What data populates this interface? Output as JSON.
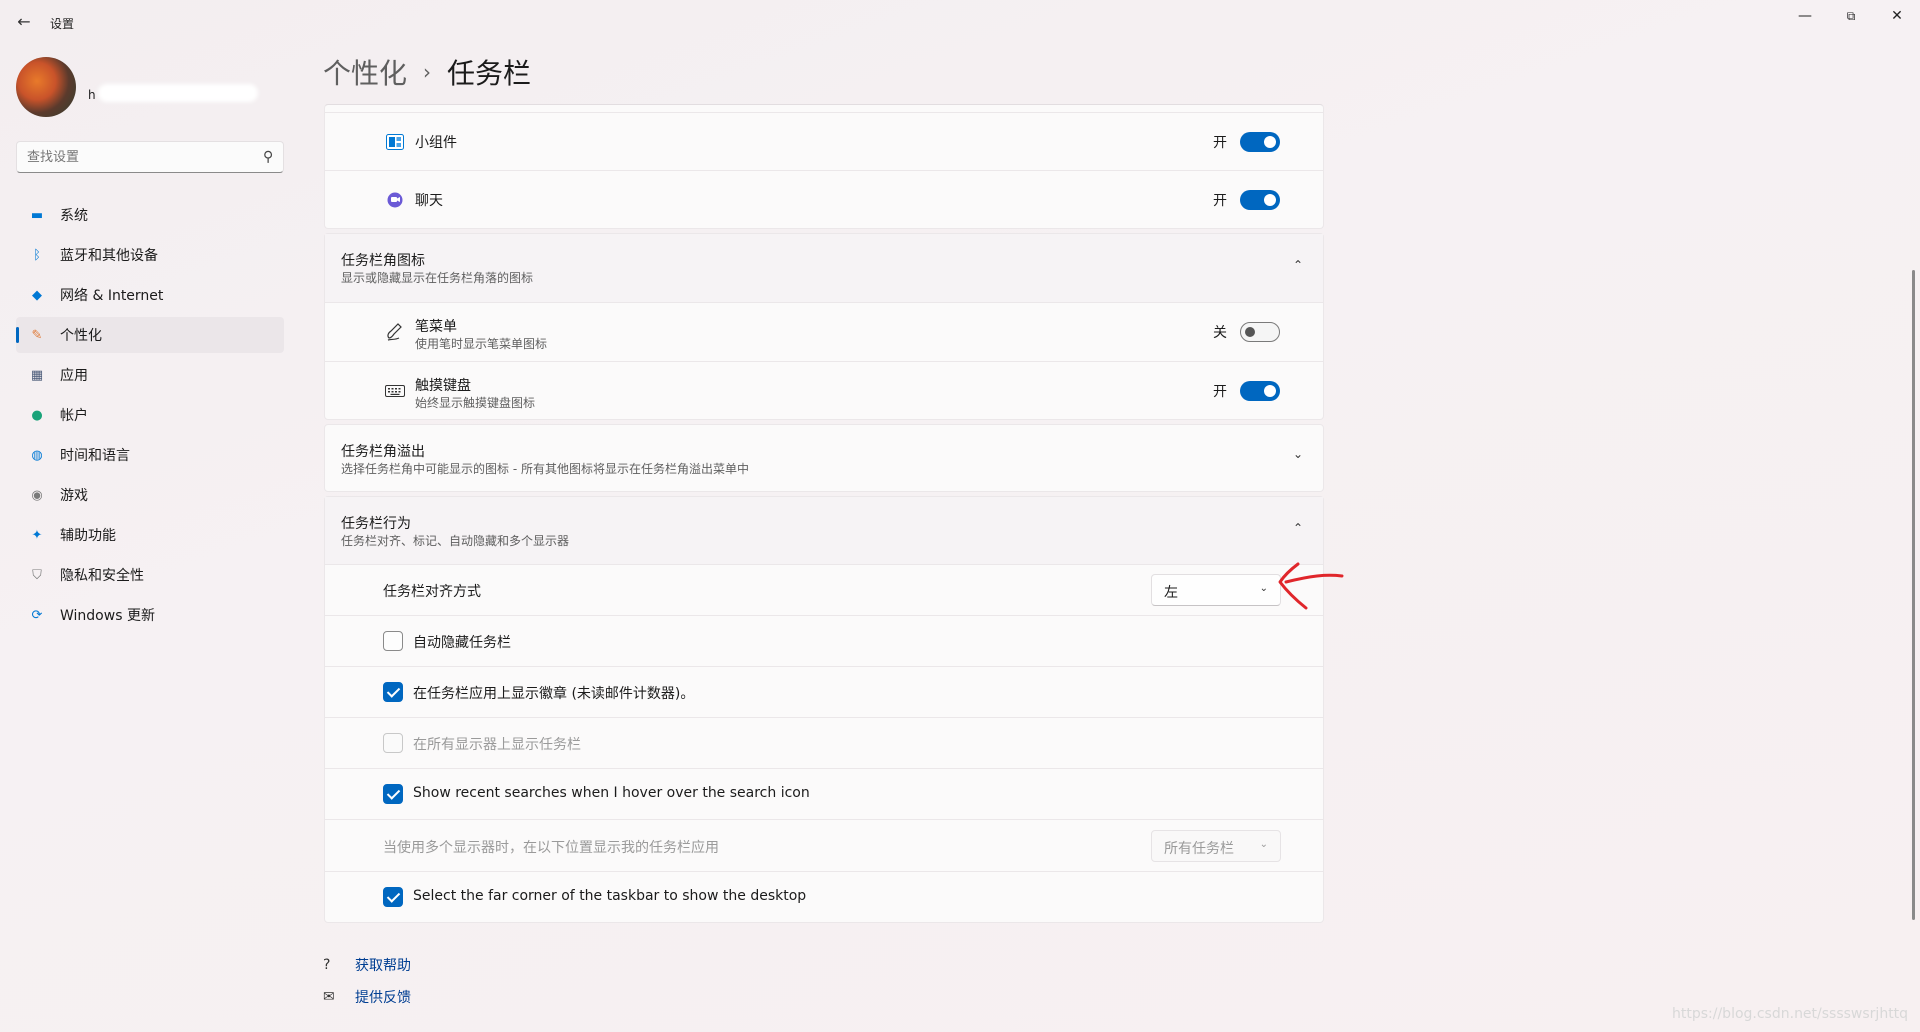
{
  "window": {
    "title": "设置",
    "back_glyph": "←",
    "minimize_glyph": "—",
    "maximize_glyph": "⧉",
    "close_glyph": "✕"
  },
  "profile": {
    "name": "h"
  },
  "search": {
    "placeholder": "查找设置",
    "icon": "search-icon"
  },
  "sidebar": {
    "items": [
      {
        "label": "系统",
        "icon": "monitor-icon",
        "glyph": "▬",
        "color": "#0078d4"
      },
      {
        "label": "蓝牙和其他设备",
        "icon": "bluetooth-icon",
        "glyph": "ᛒ",
        "color": "#0078d4"
      },
      {
        "label": "网络 & Internet",
        "icon": "wifi-icon",
        "glyph": "◆",
        "color": "#0078d4"
      },
      {
        "label": "个性化",
        "icon": "brush-icon",
        "glyph": "✎",
        "color": "#e07b39",
        "active": true
      },
      {
        "label": "应用",
        "icon": "apps-icon",
        "glyph": "▦",
        "color": "#4a5a78"
      },
      {
        "label": "帐户",
        "icon": "person-icon",
        "glyph": "●",
        "color": "#1aa37a"
      },
      {
        "label": "时间和语言",
        "icon": "globe-clock-icon",
        "glyph": "◍",
        "color": "#0078d4"
      },
      {
        "label": "游戏",
        "icon": "gamepad-icon",
        "glyph": "◉",
        "color": "#7a7a7a"
      },
      {
        "label": "辅助功能",
        "icon": "accessibility-icon",
        "glyph": "✦",
        "color": "#0078d4"
      },
      {
        "label": "隐私和安全性",
        "icon": "shield-icon",
        "glyph": "⛉",
        "color": "#7a7a7a"
      },
      {
        "label": "Windows 更新",
        "icon": "update-icon",
        "glyph": "⟳",
        "color": "#0078d4"
      }
    ]
  },
  "breadcrumb": {
    "parent": "个性化",
    "separator": "›",
    "current": "任务栏"
  },
  "taskbar_items": {
    "widgets": {
      "label": "小组件",
      "state_text": "开",
      "on": true
    },
    "chat": {
      "label": "聊天",
      "state_text": "开",
      "on": true
    }
  },
  "corner_icons": {
    "title": "任务栏角图标",
    "subtitle": "显示或隐藏显示在任务栏角落的图标",
    "chevron": "⌃",
    "pen": {
      "label": "笔菜单",
      "sub": "使用笔时显示笔菜单图标",
      "state_text": "关",
      "on": false
    },
    "keyboard": {
      "label": "触摸键盘",
      "sub": "始终显示触摸键盘图标",
      "state_text": "开",
      "on": true
    }
  },
  "corner_overflow": {
    "title": "任务栏角溢出",
    "subtitle": "选择任务栏角中可能显示的图标 - 所有其他图标将显示在任务栏角溢出菜单中",
    "chevron": "⌄"
  },
  "behaviors": {
    "title": "任务栏行为",
    "subtitle": "任务栏对齐、标记、自动隐藏和多个显示器",
    "chevron": "⌃",
    "alignment": {
      "label": "任务栏对齐方式",
      "value": "左"
    },
    "auto_hide": {
      "label": "自动隐藏任务栏",
      "checked": false
    },
    "badges": {
      "label": "在任务栏应用上显示徽章 (未读邮件计数器)。",
      "checked": true
    },
    "all_displays": {
      "label": "在所有显示器上显示任务栏",
      "checked": false,
      "disabled": true
    },
    "recent_searches": {
      "label": "Show recent searches when I hover over the search icon",
      "checked": true
    },
    "multi_display": {
      "label": "当使用多个显示器时，在以下位置显示我的任务栏应用",
      "value": "所有任务栏",
      "disabled": true
    },
    "far_corner": {
      "label": "Select the far corner of the taskbar to show the desktop",
      "checked": true
    }
  },
  "footer": {
    "help": {
      "label": "获取帮助",
      "glyph": "?"
    },
    "feedback": {
      "label": "提供反馈",
      "glyph": "✉"
    }
  },
  "annotation": {
    "color": "#e0262b"
  },
  "watermark": "https://blog.csdn.net/sssswsrjhttq"
}
